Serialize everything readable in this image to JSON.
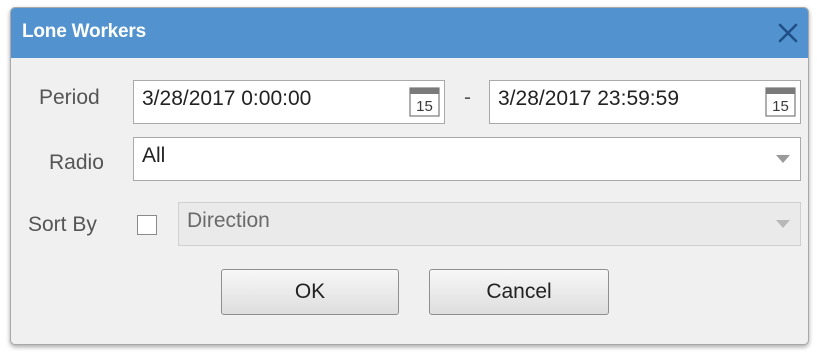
{
  "dialog": {
    "title": "Lone Workers",
    "close_icon": "close-icon",
    "accent_color": "#5293cf"
  },
  "form": {
    "period_label": "Period",
    "period_start": "3/28/2017 0:00:00",
    "period_end": "3/28/2017 23:59:59",
    "period_separator": "-",
    "calendar_icon_text": "15",
    "radio_label": "Radio",
    "radio_value": "All",
    "sort_by_label": "Sort By",
    "sort_by_checked": false,
    "sort_by_value": "Direction"
  },
  "buttons": {
    "ok": "OK",
    "cancel": "Cancel"
  }
}
